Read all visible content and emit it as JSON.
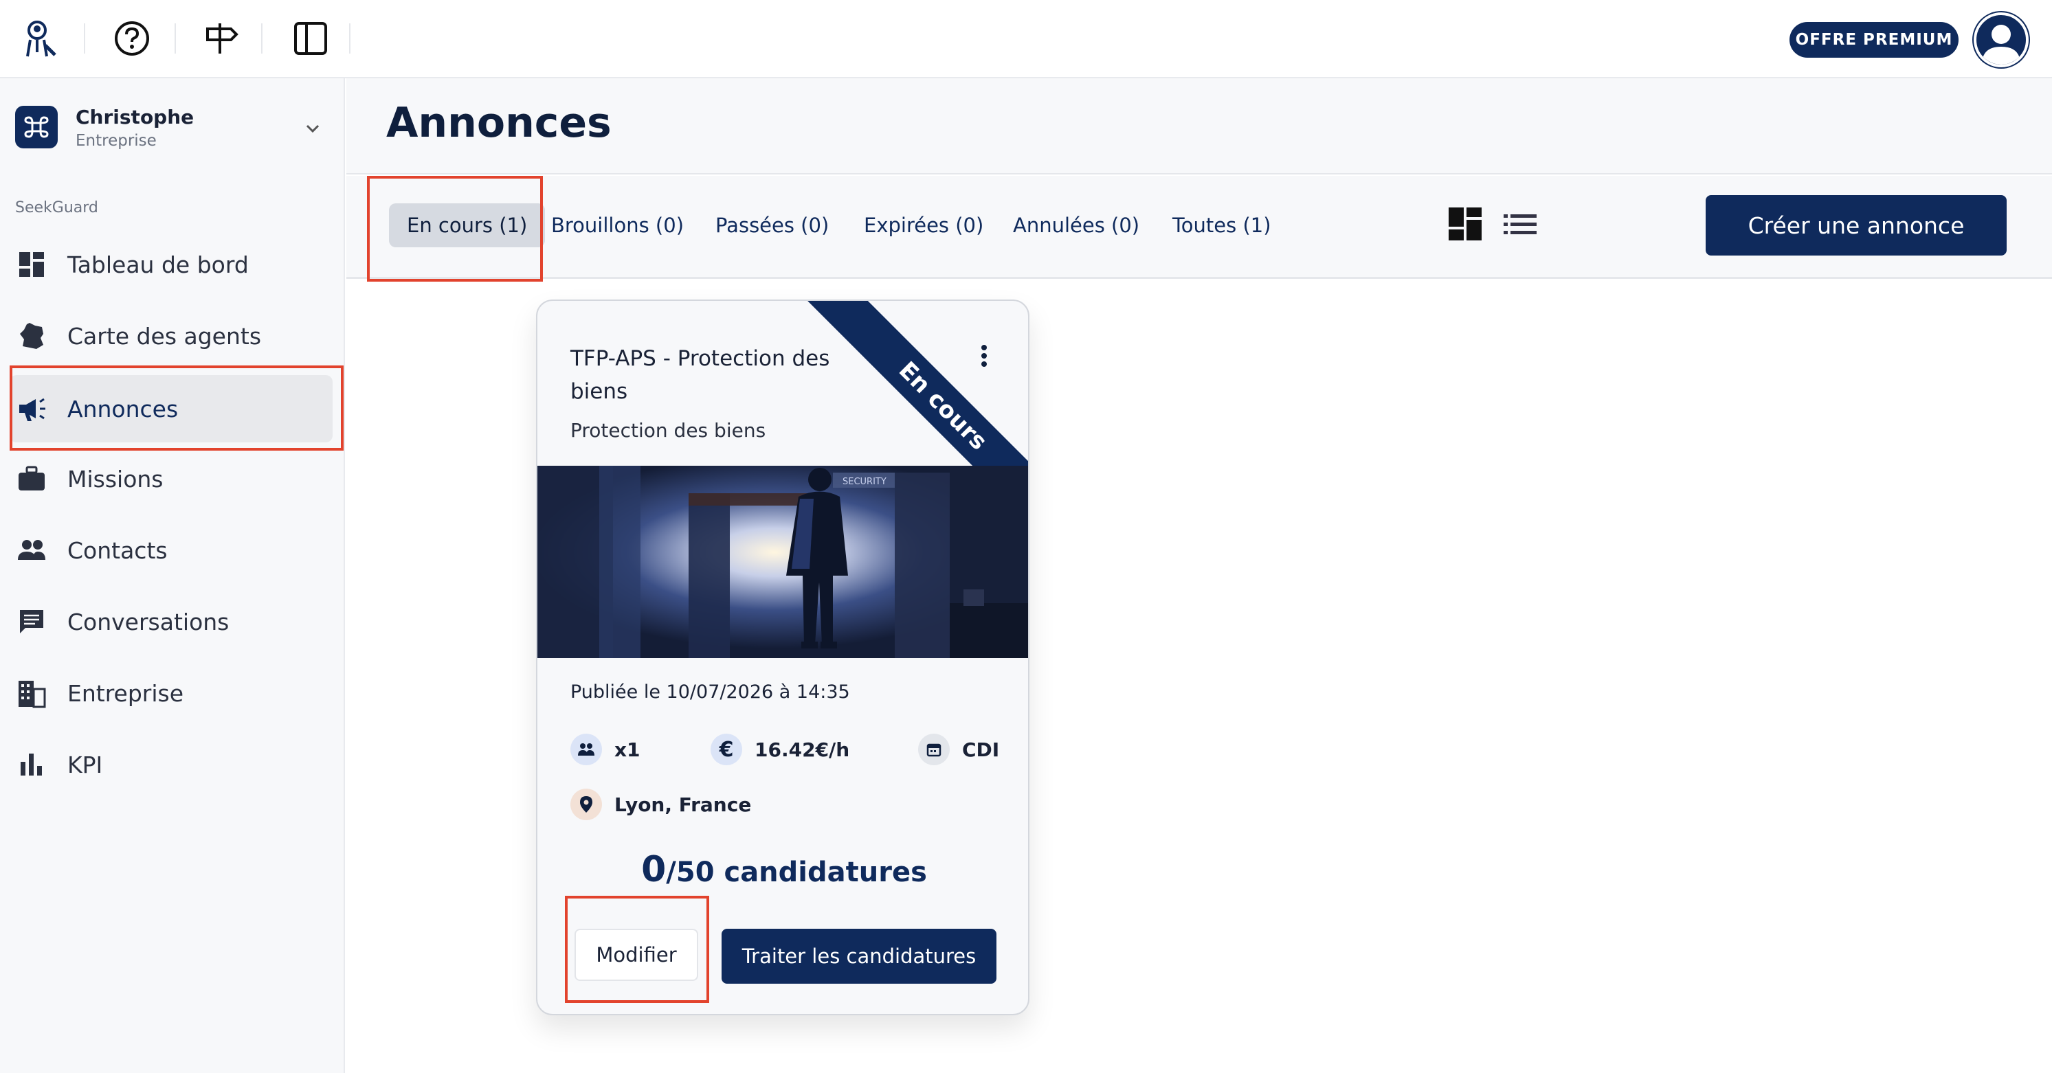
{
  "topbar": {
    "premium_label": "OFFRE PREMIUM",
    "icons": [
      "agent-logo-icon",
      "help-icon",
      "signpost-icon",
      "sidebar-toggle-icon"
    ]
  },
  "org": {
    "name": "Christophe",
    "type": "Entreprise"
  },
  "sidebar": {
    "section": "SeekGuard",
    "items": [
      {
        "label": "Tableau de bord",
        "icon": "dashboard-icon"
      },
      {
        "label": "Carte des agents",
        "icon": "france-map-icon"
      },
      {
        "label": "Annonces",
        "icon": "megaphone-icon",
        "active": true
      },
      {
        "label": "Missions",
        "icon": "briefcase-icon"
      },
      {
        "label": "Contacts",
        "icon": "people-icon"
      },
      {
        "label": "Conversations",
        "icon": "chat-icon"
      },
      {
        "label": "Entreprise",
        "icon": "building-icon"
      },
      {
        "label": "KPI",
        "icon": "bar-chart-icon"
      }
    ]
  },
  "page": {
    "title": "Annonces"
  },
  "tabs": [
    {
      "label": "En cours (1)",
      "active": true
    },
    {
      "label": "Brouillons (0)"
    },
    {
      "label": "Passées (0)"
    },
    {
      "label": "Expirées (0)"
    },
    {
      "label": "Annulées (0)"
    },
    {
      "label": "Toutes (1)"
    }
  ],
  "create_label": "Créer une annonce",
  "card": {
    "title": "TFP-APS - Protection des biens",
    "subtitle": "Protection des biens",
    "ribbon": "En cours",
    "published": "Publiée le 10/07/2026 à 14:35",
    "headcount": "x1",
    "rate": "16.42€/h",
    "contract": "CDI",
    "location": "Lyon, France",
    "applications_count": "0",
    "applications_total": "/50 candidatures",
    "modify_label": "Modifier",
    "process_label": "Traiter les candidatures",
    "image_sign": "SECURITY"
  },
  "colors": {
    "navy": "#0f2a5c",
    "highlight_red": "#e2432d",
    "sidebar_bg": "#f7f8fa"
  }
}
